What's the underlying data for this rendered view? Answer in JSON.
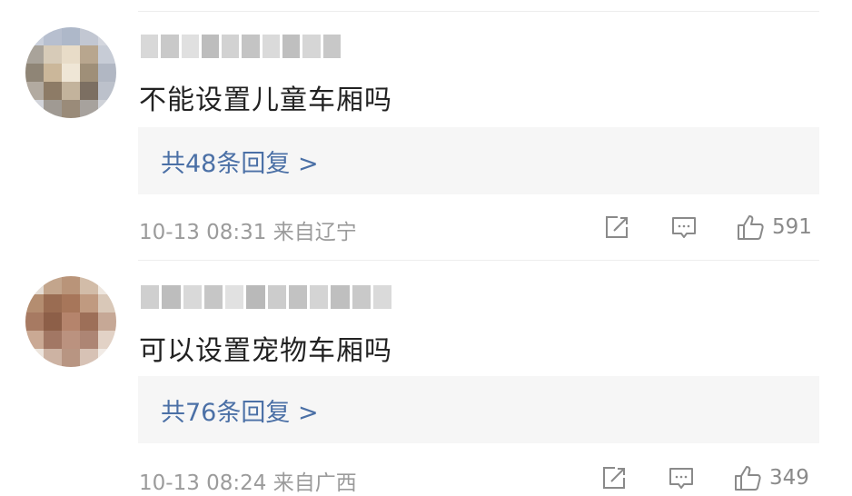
{
  "comments": [
    {
      "text": "不能设置儿童车厢吗",
      "reply_label": "共48条回复 >",
      "meta": "10-13 08:31 来自辽宁",
      "likes": "591",
      "avatar_colors": [
        "#c9cfdb",
        "#b7bfcf",
        "#aeb8c9",
        "#c2c7d2",
        "#d3d6de",
        "#a9a39a",
        "#d7cbb8",
        "#e8dcc8",
        "#b8a68e",
        "#c7ccd6",
        "#8f8576",
        "#cbb79a",
        "#efe6d6",
        "#9f8f78",
        "#b1b7c3",
        "#b2aaa0",
        "#8d7b66",
        "#c3b39c",
        "#7c6f62",
        "#bcc1cb",
        "#d2d4da",
        "#a09a93",
        "#9a8b79",
        "#a7a29d",
        "#cfd2d8"
      ],
      "username_colors": [
        "#d8d8d8",
        "#c9c9c9",
        "#e0e0e0",
        "#bdbdbd",
        "#d2d2d2",
        "#c4c4c4",
        "#dadada",
        "#bfbfbf",
        "#d6d6d6",
        "#c8c8c8"
      ]
    },
    {
      "text": "可以设置宠物车厢吗",
      "reply_label": "共76条回复 >",
      "meta": "10-13 08:24 来自广西",
      "likes": "349",
      "avatar_colors": [
        "#e4dcd4",
        "#c3a58c",
        "#b99479",
        "#d2bca8",
        "#eee6de",
        "#b48d70",
        "#9a6c52",
        "#a7765a",
        "#c09a80",
        "#d9c8b8",
        "#a77a62",
        "#8d5f48",
        "#b5846c",
        "#9d6f58",
        "#c6a896",
        "#caa994",
        "#a27764",
        "#bb927f",
        "#ad8574",
        "#e2d2c6",
        "#ece4dc",
        "#cdb3a3",
        "#b89582",
        "#d7c2b5",
        "#f1ebe6"
      ],
      "username_colors": [
        "#cfcfcf",
        "#bdbdbd",
        "#d9d9d9",
        "#c6c6c6",
        "#e1e1e1",
        "#b9b9b9",
        "#cccccc",
        "#c2c2c2",
        "#d4d4d4",
        "#bfbfbf",
        "#c9c9c9",
        "#dadada"
      ]
    }
  ],
  "icons": {
    "share": "share-icon",
    "comment": "comment-icon",
    "like": "thumbs-up-icon"
  },
  "colors": {
    "reply_link": "#4b70a6",
    "reply_bg": "#f6f6f6",
    "meta_text": "#9b9b9b"
  }
}
